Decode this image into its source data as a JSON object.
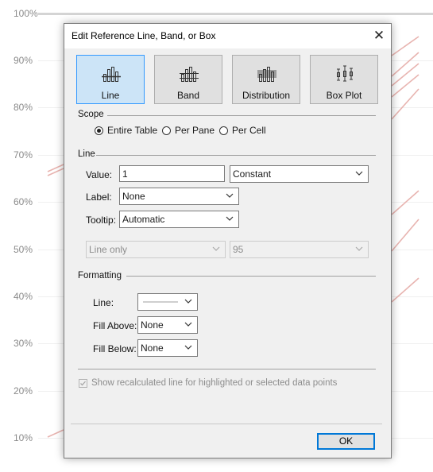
{
  "background": {
    "axis_labels": [
      "100%",
      "90%",
      "80%",
      "70%",
      "60%",
      "50%",
      "40%",
      "30%",
      "20%",
      "10%"
    ],
    "line_color": "#e8b4b0"
  },
  "dialog": {
    "title": "Edit Reference Line, Band, or Box",
    "types": [
      {
        "label": "Line",
        "selected": true,
        "icon": "line-bar-icon"
      },
      {
        "label": "Band",
        "selected": false,
        "icon": "band-bar-icon"
      },
      {
        "label": "Distribution",
        "selected": false,
        "icon": "distribution-bar-icon"
      },
      {
        "label": "Box Plot",
        "selected": false,
        "icon": "box-plot-icon"
      }
    ],
    "scope": {
      "heading": "Scope",
      "options": [
        "Entire Table",
        "Per Pane",
        "Per Cell"
      ],
      "selected": "Entire Table"
    },
    "line": {
      "heading": "Line",
      "value_label": "Value:",
      "value": "1",
      "value_type": "Constant",
      "label_label": "Label:",
      "label_value": "None",
      "tooltip_label": "Tooltip:",
      "tooltip_value": "Automatic",
      "line_only": "Line only",
      "confidence": "95"
    },
    "formatting": {
      "heading": "Formatting",
      "line_label": "Line:",
      "fill_above_label": "Fill Above:",
      "fill_above_value": "None",
      "fill_below_label": "Fill Below:",
      "fill_below_value": "None"
    },
    "recalc_checkbox": "Show recalculated line for highlighted or selected data points",
    "ok_label": "OK",
    "accent_color": "#0078d7",
    "selected_fill": "#cce4f7"
  }
}
